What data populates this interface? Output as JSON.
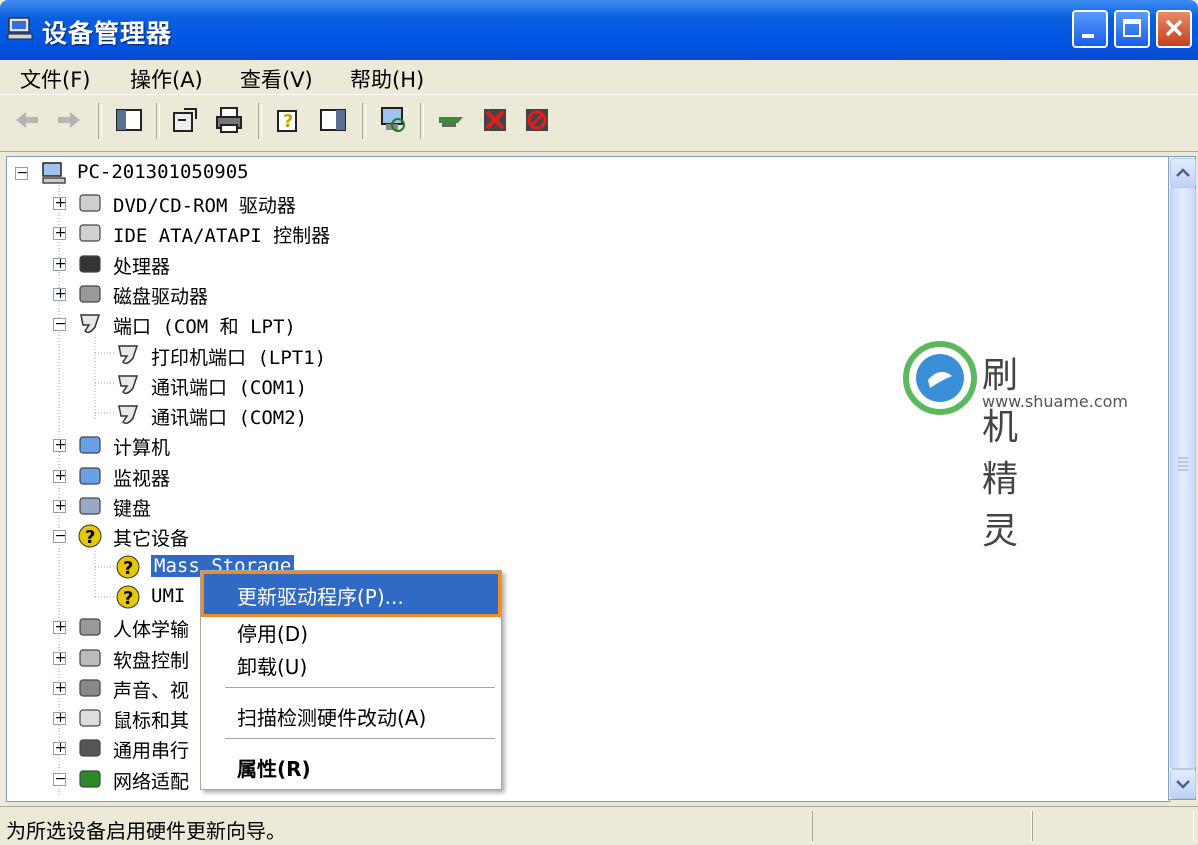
{
  "window": {
    "title": "设备管理器"
  },
  "menu": [
    "文件(F)",
    "操作(A)",
    "查看(V)",
    "帮助(H)"
  ],
  "toolbar": {
    "buttons": [
      "back-icon",
      "forward-icon",
      "show-hide-tree-icon",
      "properties-icon",
      "print-icon",
      "help-icon",
      "view-icon",
      "scan-hardware-icon",
      "update-driver-icon",
      "uninstall-icon",
      "disable-icon"
    ]
  },
  "tree": {
    "root": "PC-201301050905",
    "items": [
      {
        "label": "DVD/CD-ROM 驱动器",
        "expander": "+"
      },
      {
        "label": "IDE ATA/ATAPI 控制器",
        "expander": "+"
      },
      {
        "label": "处理器",
        "expander": "+"
      },
      {
        "label": "磁盘驱动器",
        "expander": "+"
      },
      {
        "label": "端口 (COM 和 LPT)",
        "expander": "−"
      },
      {
        "label": "打印机端口 (LPT1)"
      },
      {
        "label": "通讯端口 (COM1)"
      },
      {
        "label": "通讯端口 (COM2)"
      },
      {
        "label": "计算机",
        "expander": "+"
      },
      {
        "label": "监视器",
        "expander": "+"
      },
      {
        "label": "键盘",
        "expander": "+"
      },
      {
        "label": "其它设备",
        "expander": "−"
      },
      {
        "label": "Mass Storage"
      },
      {
        "label": "UMI"
      },
      {
        "label": "人体学输",
        "expander": "+"
      },
      {
        "label": "软盘控制",
        "expander": "+"
      },
      {
        "label": "声音、视",
        "expander": "+"
      },
      {
        "label": "鼠标和其",
        "expander": "+"
      },
      {
        "label": "通用串行",
        "expander": "+"
      },
      {
        "label": "网络适配",
        "expander": "−"
      }
    ]
  },
  "watermark": {
    "title": "刷机精灵",
    "url": "www.shuame.com"
  },
  "context_menu": {
    "items": [
      "更新驱动程序(P)...",
      "停用(D)",
      "卸载(U)",
      "扫描检测硬件改动(A)",
      "属性(R)"
    ]
  },
  "status": {
    "text": "为所选设备启用硬件更新向导。"
  }
}
